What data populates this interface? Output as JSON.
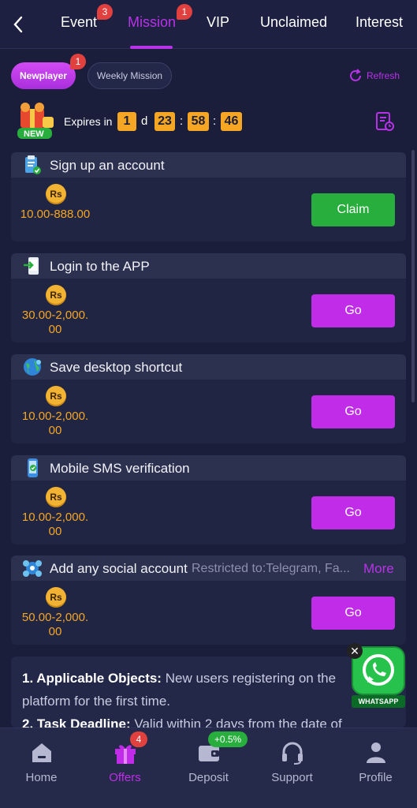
{
  "header": {
    "tabs": [
      {
        "label": "Event",
        "badge": "3"
      },
      {
        "label": "Mission",
        "badge": "1",
        "active": true
      },
      {
        "label": "VIP"
      },
      {
        "label": "Unclaimed"
      },
      {
        "label": "Interest"
      }
    ]
  },
  "subtabs": {
    "newplayer": {
      "label": "Newplayer",
      "badge": "1"
    },
    "weekly": {
      "label": "Weekly Mission"
    },
    "refresh": "Refresh"
  },
  "timer": {
    "label": "Expires in",
    "days": "1",
    "days_unit": "d",
    "hours": "23",
    "minutes": "58",
    "seconds": "46",
    "sep": ":",
    "new_label": "NEW"
  },
  "currency_symbol": "Rs",
  "missions": [
    {
      "title": "Sign up an account",
      "reward": "10.00-888.00",
      "button": "Claim",
      "icon": "clipboard-check-icon"
    },
    {
      "title": "Login to the APP",
      "reward": "30.00-2,000.00",
      "button": "Go",
      "icon": "phone-login-icon"
    },
    {
      "title": "Save desktop shortcut",
      "reward": "10.00-2,000.00",
      "button": "Go",
      "icon": "globe-icon"
    },
    {
      "title": "Mobile SMS verification",
      "reward": "10.00-2,000.00",
      "button": "Go",
      "icon": "sms-phone-icon"
    },
    {
      "title": "Add any social account",
      "restrict": "Restricted to:Telegram, Fa...",
      "more": "More",
      "reward": "50.00-2,000.00",
      "button": "Go",
      "icon": "social-icon"
    }
  ],
  "rules": {
    "line1_bold": "1. Applicable Objects:",
    "line1_text": " New users registering on the platform for the first time.",
    "line2_bold": "2. Task Deadline:",
    "line2_text": " Valid within 2 days from the date of"
  },
  "whatsapp": {
    "label": "WHATSAPP",
    "close": "✕"
  },
  "bottom_nav": [
    {
      "label": "Home"
    },
    {
      "label": "Offers",
      "badge": "4",
      "active": true
    },
    {
      "label": "Deposit",
      "badge": "+0.5%"
    },
    {
      "label": "Support"
    },
    {
      "label": "Profile"
    }
  ],
  "colors": {
    "accent": "#c02ce8",
    "claim": "#27ae3c",
    "timer": "#f5a623",
    "background": "#1b1e3b"
  }
}
